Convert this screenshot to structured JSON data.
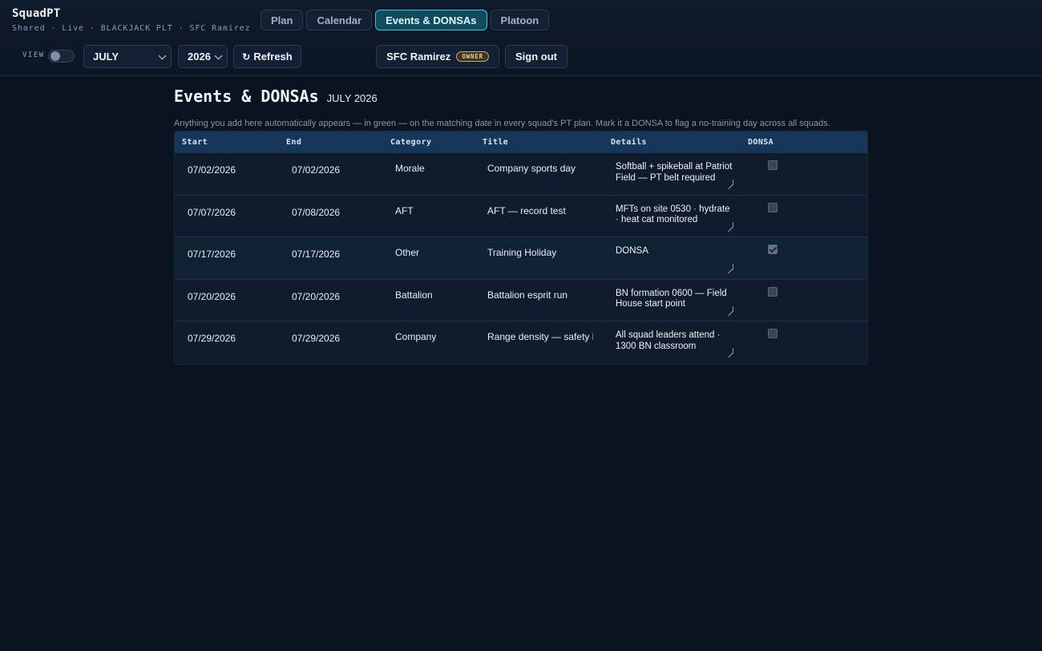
{
  "app": {
    "name": "SquadPT",
    "subtitle": "Shared · Live · BLACKJACK PLT · SFC Ramirez"
  },
  "tabs": [
    {
      "label": "Plan",
      "active": false
    },
    {
      "label": "Calendar",
      "active": false
    },
    {
      "label": "Events & DONSAs",
      "active": true
    },
    {
      "label": "Platoon",
      "active": false
    }
  ],
  "toolbar": {
    "view_label": "VIEW",
    "month": "JULY",
    "year": "2026",
    "refresh_icon": "↻",
    "refresh_label": "Refresh",
    "user_name": "SFC Ramirez",
    "role_badge": "OWNER",
    "signout_label": "Sign out"
  },
  "page": {
    "title": "Events & DONSAs",
    "period": "JULY 2026",
    "hint": "Anything you add here automatically appears — in green — on the matching date in every squad's PT plan. Mark it a DONSA to flag a no-training day across all squads."
  },
  "table": {
    "headers": {
      "start": "Start",
      "end": "End",
      "category": "Category",
      "title": "Title",
      "details": "Details",
      "donsa": "DONSA"
    },
    "rows": [
      {
        "start": "07/02/2026",
        "end": "07/02/2026",
        "category": "Morale",
        "title": "Company sports day",
        "details": "Softball + spikeball at Patriot Field — PT belt required",
        "donsa": false
      },
      {
        "start": "07/07/2026",
        "end": "07/08/2026",
        "category": "AFT",
        "title": "AFT — record test",
        "details": "MFTs on site 0530 · hydrate · heat cat monitored",
        "donsa": false
      },
      {
        "start": "07/17/2026",
        "end": "07/17/2026",
        "category": "Other",
        "title": "Training Holiday",
        "details": "DONSA",
        "donsa": true
      },
      {
        "start": "07/20/2026",
        "end": "07/20/2026",
        "category": "Battalion",
        "title": "Battalion esprit run",
        "details": "BN formation 0600 — Field House start point",
        "donsa": false
      },
      {
        "start": "07/29/2026",
        "end": "07/29/2026",
        "category": "Company",
        "title": "Range density — safety brief",
        "details": "All squad leaders attend · 1300 BN classroom",
        "donsa": false
      }
    ]
  },
  "colors": {
    "background": "#0a1320",
    "accent": "#3fc3d6",
    "table_header": "#17375a",
    "badge": "#c7b27a"
  }
}
